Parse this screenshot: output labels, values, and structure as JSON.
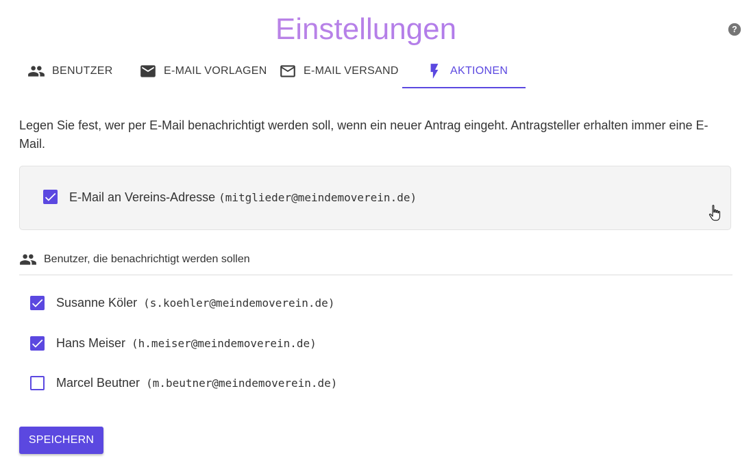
{
  "page": {
    "title": "Einstellungen"
  },
  "tabs": [
    {
      "label": "BENUTZER",
      "icon": "people-icon",
      "active": false
    },
    {
      "label": "E-MAIL VORLAGEN",
      "icon": "mail-filled-icon",
      "active": false
    },
    {
      "label": "E-MAIL VERSAND",
      "icon": "mail-outline-icon",
      "active": false
    },
    {
      "label": "AKTIONEN",
      "icon": "bolt-icon",
      "active": true
    }
  ],
  "description": "Legen Sie fest, wer per E-Mail benachrichtigt werden soll, wenn ein neuer Antrag eingeht. Antragsteller erhalten immer eine E-Mail.",
  "club_email": {
    "label": "E-Mail an Vereins-Adresse",
    "address": "(mitglieder@meindemoverein.de)",
    "checked": true
  },
  "users_section": {
    "title": "Benutzer, die benachrichtigt werden sollen",
    "icon": "people-icon"
  },
  "users": [
    {
      "name": "Susanne Köler",
      "email": "(s.koehler@meindemoverein.de)",
      "checked": true
    },
    {
      "name": "Hans Meiser",
      "email": "(h.meiser@meindemoverein.de)",
      "checked": true
    },
    {
      "name": "Marcel Beutner",
      "email": "(m.beutner@meindemoverein.de)",
      "checked": false
    }
  ],
  "save_label": "SPEICHERN",
  "colors": {
    "accent": "#5b48e0",
    "title_gradient_start": "#c58de2",
    "title_gradient_end": "#a672ee"
  }
}
